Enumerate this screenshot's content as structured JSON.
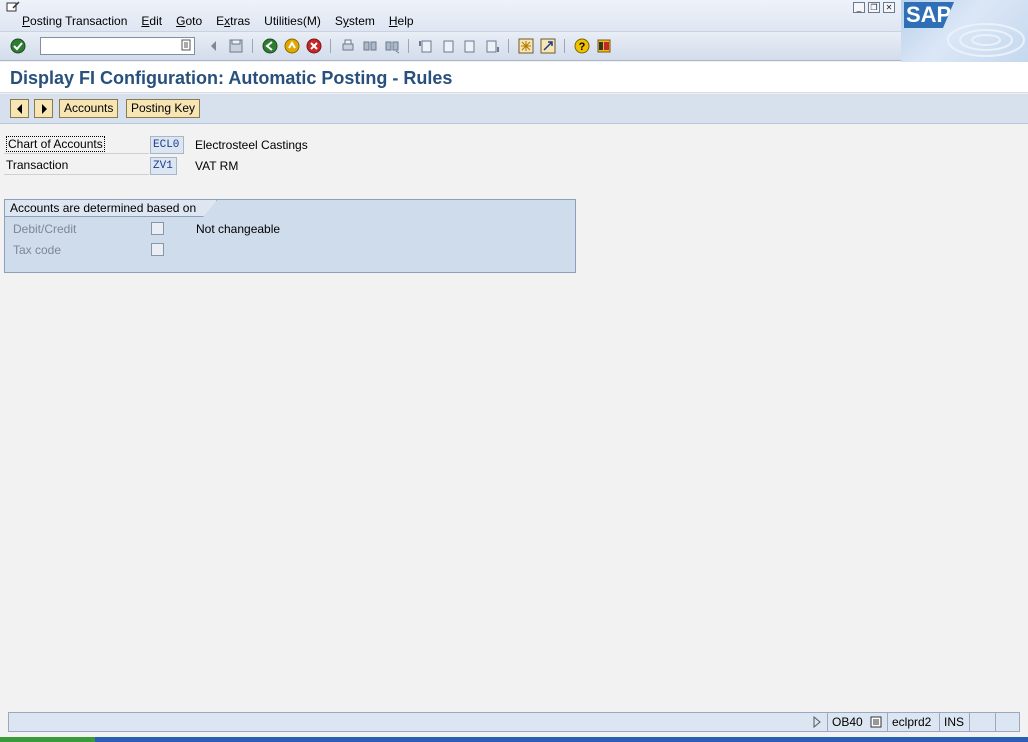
{
  "menu": {
    "items": [
      {
        "label": "Posting Transaction",
        "mnemonic": "P",
        "rest": "osting Transaction"
      },
      {
        "label": "Edit",
        "mnemonic": "E",
        "rest": "dit"
      },
      {
        "label": "Goto",
        "mnemonic": "G",
        "rest": "oto"
      },
      {
        "label": "Extras",
        "mnemonic": "x",
        "pre": "E",
        "rest": "tras"
      },
      {
        "label": "Utilities(M)",
        "mnemonic": "",
        "pre": "Utilities(M)",
        "rest": ""
      },
      {
        "label": "System",
        "mnemonic": "y",
        "pre": "S",
        "rest": "stem"
      },
      {
        "label": "Help",
        "mnemonic": "H",
        "rest": "elp"
      }
    ]
  },
  "logo": {
    "text": "SAP"
  },
  "toolbar": {
    "command_value": ""
  },
  "title": {
    "text": "Display FI Configuration: Automatic Posting - Rules"
  },
  "app_toolbar": {
    "accounts_label": "Accounts",
    "posting_key_label": "Posting Key"
  },
  "fields": {
    "chart_label": "Chart of Accounts",
    "chart_value": "ECL0",
    "chart_desc": "Electrosteel Castings",
    "transaction_label": "Transaction",
    "transaction_value": "ZV1",
    "transaction_desc": "VAT RM"
  },
  "group": {
    "title": "Accounts are determined based on",
    "debit_credit_label": "Debit/Credit",
    "tax_code_label": "Tax code",
    "note": "Not changeable"
  },
  "status": {
    "transaction_code": "OB40",
    "server": "eclprd2",
    "mode": "INS"
  },
  "colors": {
    "title": "#28507c",
    "button_fill": "#f7e5b4",
    "groupbox_fill": "#cfdceb"
  }
}
